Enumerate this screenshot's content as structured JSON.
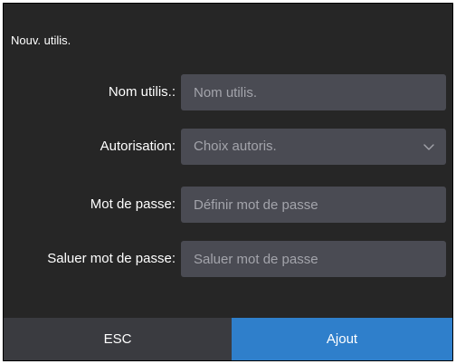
{
  "dialog": {
    "title": "Nouv. utilis."
  },
  "form": {
    "username": {
      "label": "Nom utilis.:",
      "placeholder": "Nom utilis.",
      "value": ""
    },
    "permission": {
      "label": "Autorisation:",
      "placeholder": "Choix autoris.",
      "icon": "chevron-down-icon"
    },
    "password": {
      "label": "Mot de passe:",
      "placeholder": "Définir mot de passe",
      "value": ""
    },
    "confirm_password": {
      "label": "Saluer mot de passe:",
      "placeholder": "Saluer mot de passe",
      "value": ""
    }
  },
  "footer": {
    "esc_label": "ESC",
    "add_label": "Ajout"
  },
  "colors": {
    "background": "#262626",
    "field": "#4a4b53",
    "esc_button": "#3a3b40",
    "add_button": "#2f7fcb",
    "text": "#ffffff",
    "placeholder": "#a3a4ab"
  }
}
